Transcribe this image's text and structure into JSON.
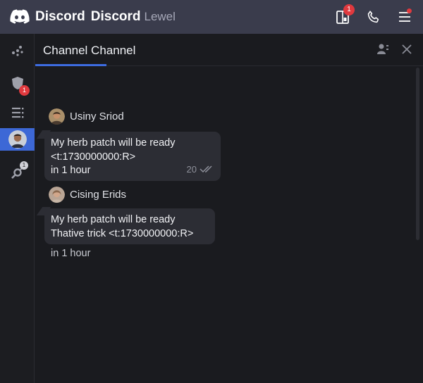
{
  "app": {
    "brand": "Discord",
    "brand_repeat": "Discord",
    "brand_sub": "Lewel"
  },
  "topbar": {
    "notifications_badge": "1",
    "icons": [
      "tablet-icon",
      "phone-icon",
      "menu-icon"
    ]
  },
  "sidebar": {
    "items": [
      {
        "name": "dots-icon"
      },
      {
        "name": "shield-icon",
        "badge": "1"
      },
      {
        "name": "list-icon"
      },
      {
        "name": "user-avatar",
        "active": true
      },
      {
        "name": "satellite-icon",
        "badge": "1"
      }
    ]
  },
  "channel": {
    "title": "Channel Channel"
  },
  "messages": [
    {
      "author": "Usiny Sriod",
      "line1": "My herb patch will be ready",
      "line2": "<t:1730000000:R>",
      "line3": "in 1 hour",
      "time": "20"
    },
    {
      "author": "Cising Erids",
      "line1": "My herb patch will be ready",
      "line2": "Thative trick <t:1730000000:R>",
      "after": "in 1 hour"
    }
  ],
  "colors": {
    "topbar": "#3a3c4c",
    "background": "#1a1b1f",
    "accent": "#3d68d6",
    "bubble": "#2c2d34",
    "badge": "#e0393e"
  }
}
